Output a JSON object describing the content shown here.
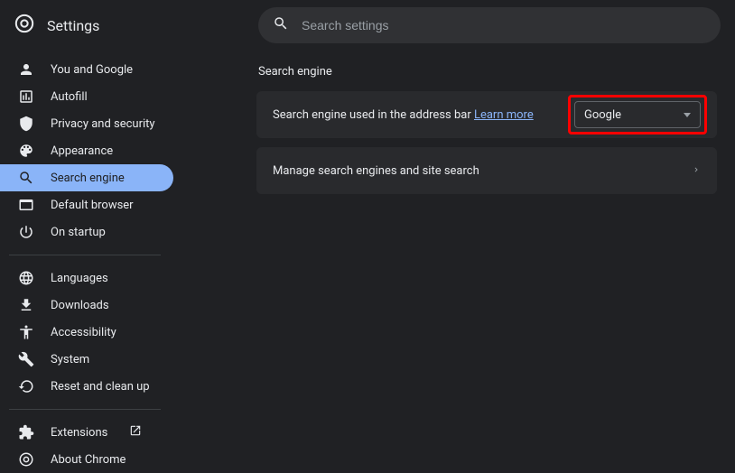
{
  "header": {
    "title": "Settings",
    "search_placeholder": "Search settings"
  },
  "sidebar": {
    "items": [
      {
        "label": "You and Google"
      },
      {
        "label": "Autofill"
      },
      {
        "label": "Privacy and security"
      },
      {
        "label": "Appearance"
      },
      {
        "label": "Search engine"
      },
      {
        "label": "Default browser"
      },
      {
        "label": "On startup"
      }
    ],
    "items2": [
      {
        "label": "Languages"
      },
      {
        "label": "Downloads"
      },
      {
        "label": "Accessibility"
      },
      {
        "label": "System"
      },
      {
        "label": "Reset and clean up"
      }
    ],
    "items3": [
      {
        "label": "Extensions"
      },
      {
        "label": "About Chrome"
      }
    ]
  },
  "main": {
    "section_title": "Search engine",
    "row1_prefix": "Search engine used in the address bar ",
    "row1_link": "Learn more",
    "dropdown_value": "Google",
    "row2_label": "Manage search engines and site search"
  }
}
